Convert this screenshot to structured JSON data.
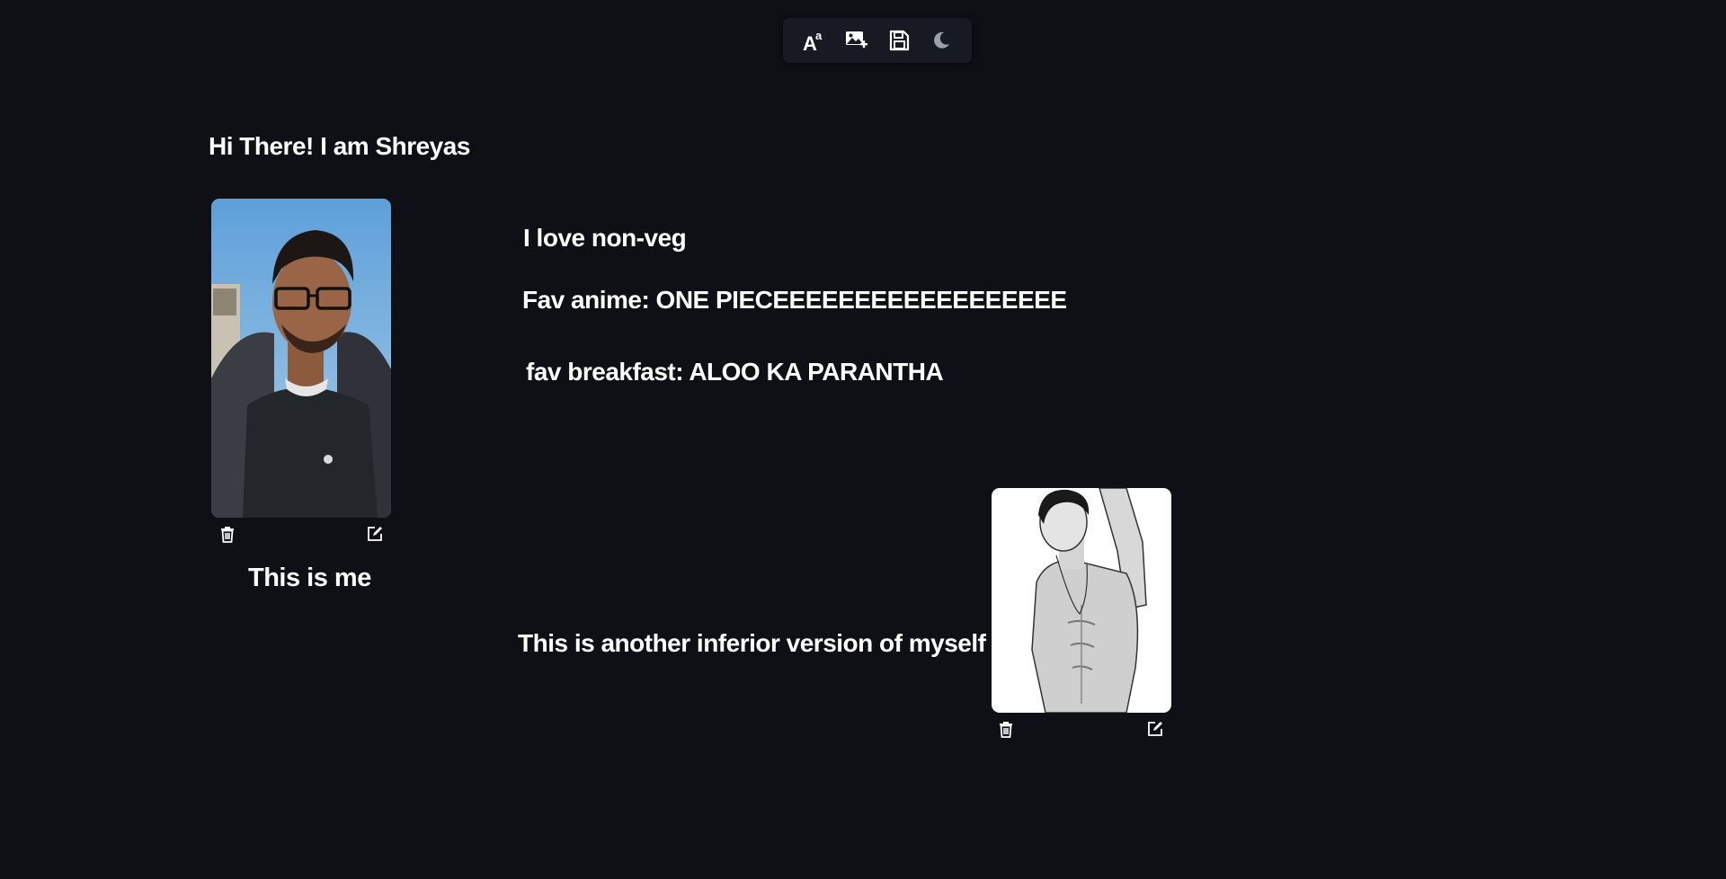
{
  "toolbar": {
    "items": [
      {
        "name": "add-text",
        "icon": "text-size-icon"
      },
      {
        "name": "add-image",
        "icon": "image-add-icon"
      },
      {
        "name": "save",
        "icon": "save-icon"
      },
      {
        "name": "theme-toggle",
        "icon": "moon-icon"
      }
    ]
  },
  "content": {
    "heading": "Hi There! I am Shreyas",
    "line1": "I love non-veg",
    "line2": "Fav anime: ONE PIECEEEEEEEEEEEEEEEEEE",
    "line3": "fav breakfast: ALOO KA PARANTHA",
    "caption_me": "This is me",
    "caption_inferior": "This is another inferior version of myself"
  },
  "images": [
    {
      "name": "self-photo",
      "description_icon": "photo",
      "actions": [
        "delete-icon",
        "edit-icon"
      ]
    },
    {
      "name": "anime-character-photo",
      "description_icon": "photo",
      "actions": [
        "delete-icon",
        "edit-icon"
      ]
    }
  ],
  "colors": {
    "background": "#0e1015",
    "toolbar": "#171a22",
    "text": "#ffffff",
    "icon_muted": "#9aa0ab"
  }
}
